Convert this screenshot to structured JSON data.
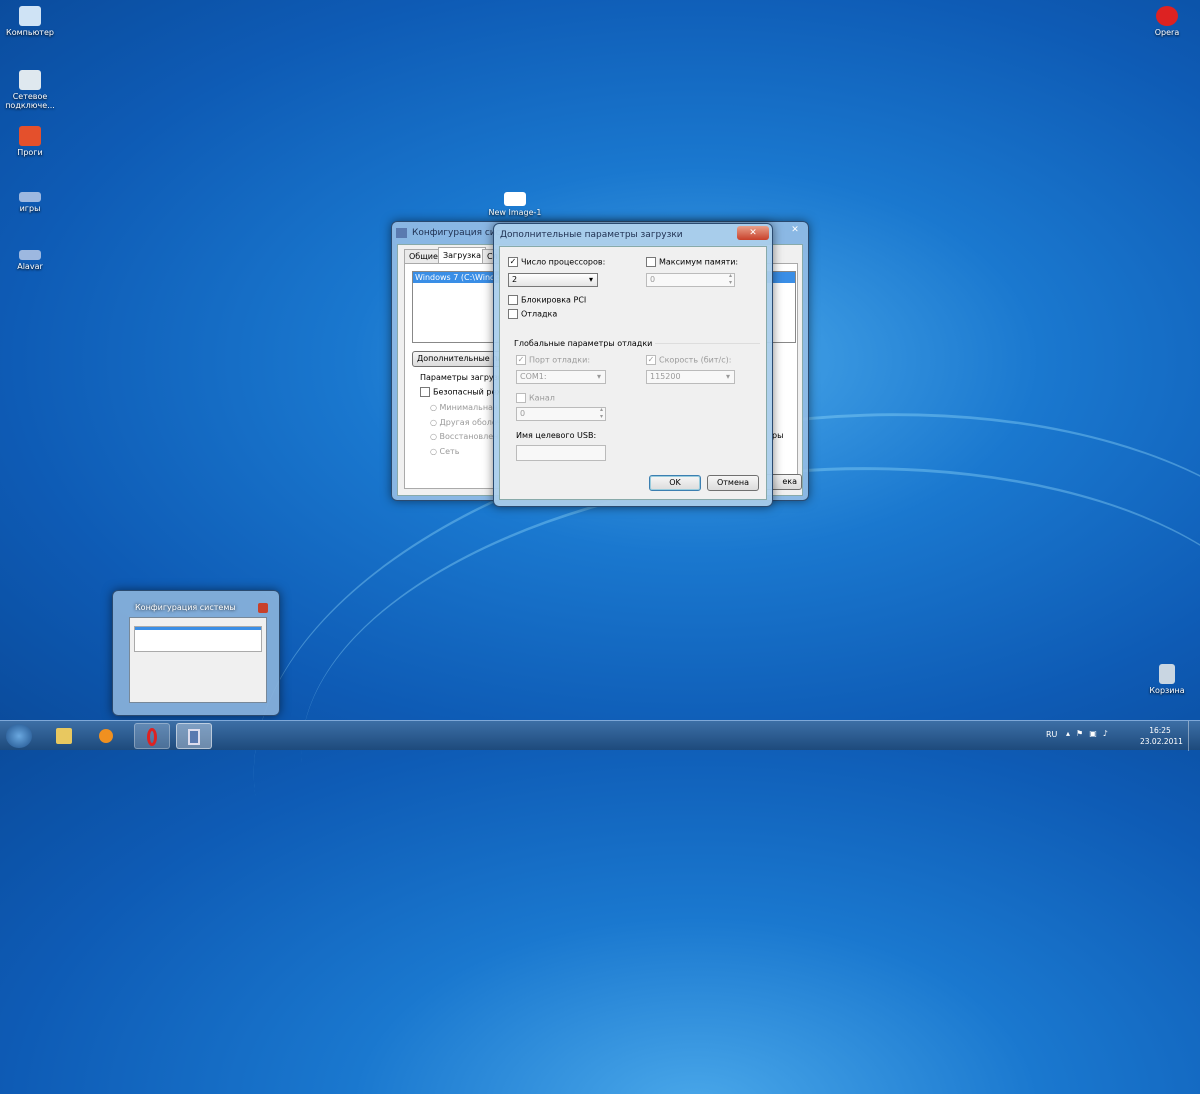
{
  "desktop": {
    "icons": [
      {
        "label": "Компьютер",
        "icon": "computer-icon"
      },
      {
        "label": "Сетевое подключе...",
        "icon": "network-icon"
      },
      {
        "label": "Проги",
        "icon": "folder-icon"
      },
      {
        "label": "игры",
        "icon": "shortcut-icon"
      },
      {
        "label": "Alavar",
        "icon": "shortcut-icon"
      },
      {
        "label": "Opera",
        "icon": "opera-icon"
      },
      {
        "label": "Корзина",
        "icon": "recycle-bin-icon"
      },
      {
        "label": "New Image-1",
        "icon": "image-file-icon"
      }
    ]
  },
  "sysconfig": {
    "title": "Конфигурация системы",
    "tabs": [
      "Общие",
      "Загрузка",
      "Сл"
    ],
    "os_entry": "Windows 7 (C:\\Windo",
    "advanced_button": "Дополнительные пар",
    "boot_params": "Параметры загрузки",
    "safe_mode": "Безопасный режи",
    "radios": [
      "Минимальная",
      "Другая оболоч",
      "Восстановлени",
      "Сеть"
    ],
    "right_text": "ры",
    "cancel_partial": "ека"
  },
  "dialog": {
    "title": "Дополнительные параметры загрузки",
    "num_processors": {
      "label": "Число процессоров:",
      "checked": true,
      "value": "2"
    },
    "max_memory": {
      "label": "Максимум памяти:",
      "checked": false,
      "value": "0"
    },
    "pci_lock": {
      "label": "Блокировка PCI",
      "checked": false
    },
    "debug": {
      "label": "Отладка",
      "checked": false
    },
    "global_debug": "Глобальные параметры отладки",
    "debug_port": {
      "label": "Порт отладки:",
      "checked": true,
      "value": "COM1:"
    },
    "baud_rate": {
      "label": "Скорость (бит/с):",
      "checked": true,
      "value": "115200"
    },
    "channel": {
      "label": "Канал",
      "checked": false,
      "value": "0"
    },
    "usb_target": {
      "label": "Имя целевого USB:",
      "value": ""
    },
    "ok": "OK",
    "cancel": "Отмена"
  },
  "thumbnail": {
    "title": "Конфигурация системы"
  },
  "taskbar": {
    "lang": "RU",
    "time": "16:25",
    "date": "23.02.2011"
  }
}
